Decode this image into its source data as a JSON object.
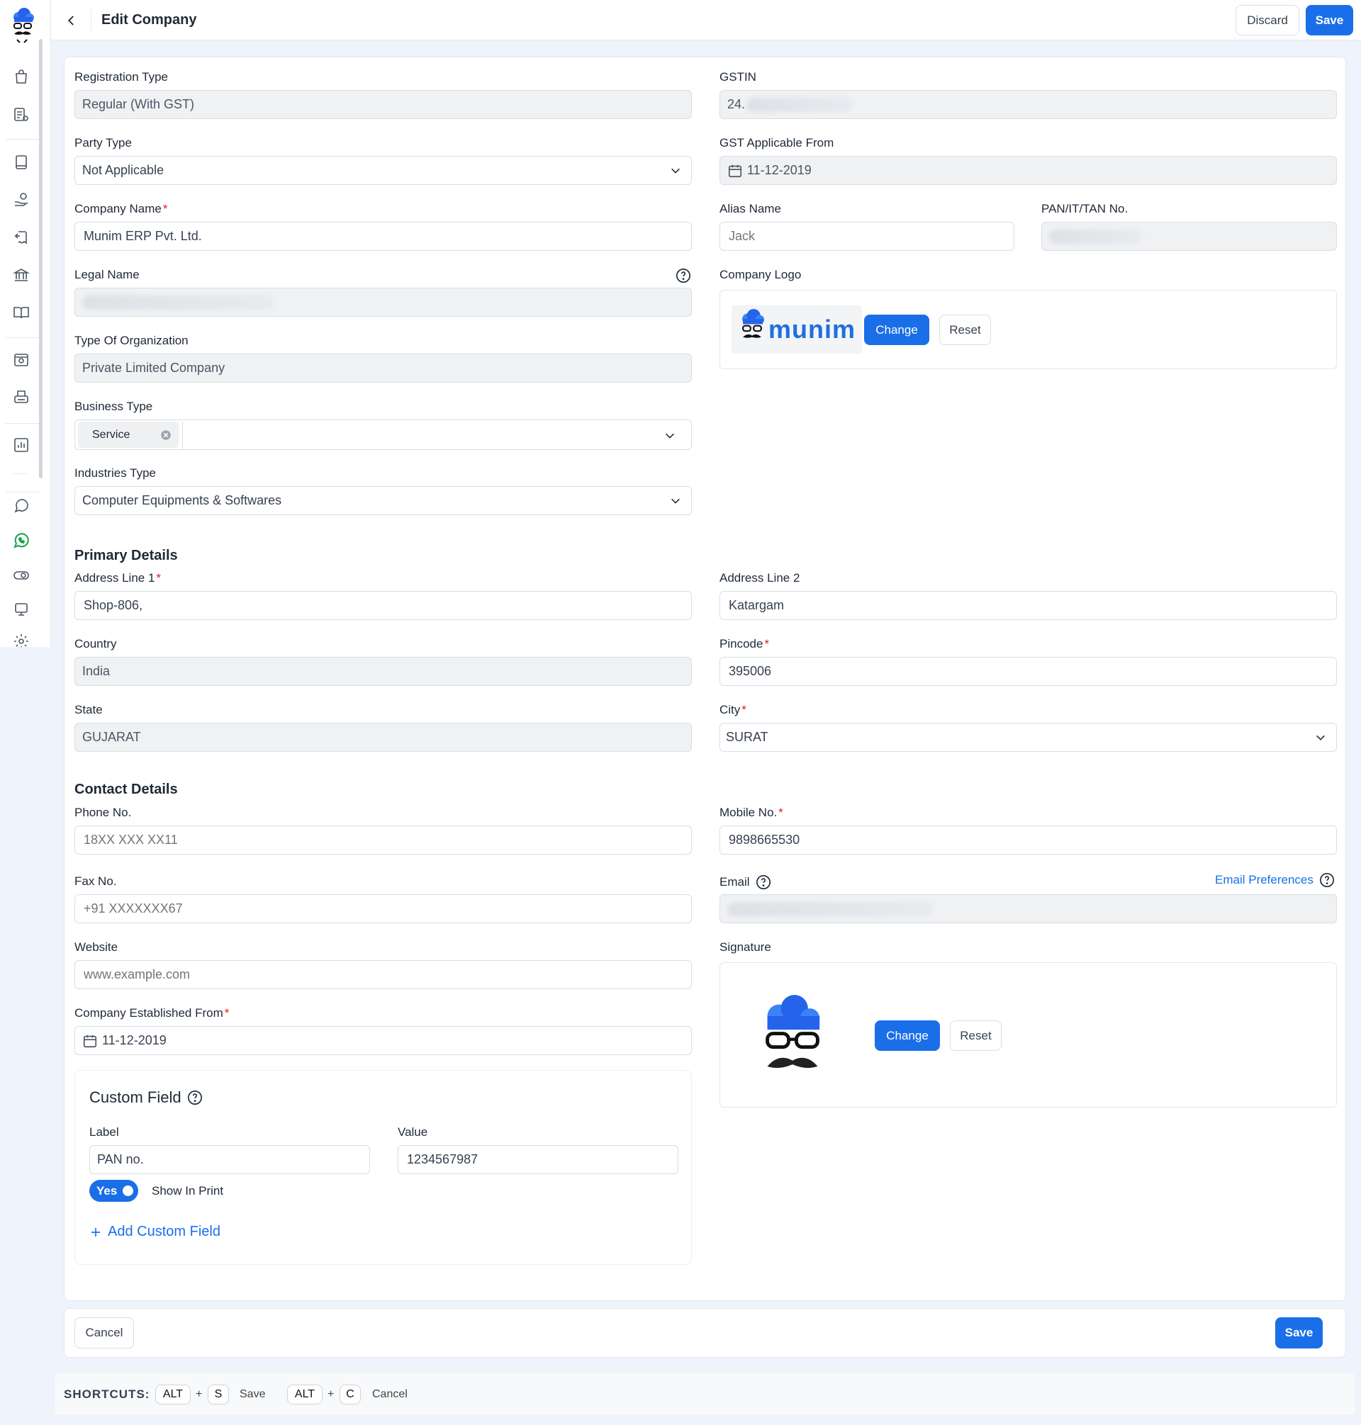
{
  "header": {
    "title": "Edit Company",
    "discard": "Discard",
    "save": "Save"
  },
  "sidebar": {
    "icons": [
      "cloud-logo-icon",
      "bag-icon",
      "list-icon",
      "book-icon",
      "hand-coins-icon",
      "return-icon",
      "bank-icon",
      "open-book-icon",
      "settings-box-icon",
      "printer-icon",
      "bar-chart-icon",
      "chat-icon",
      "whatsapp-icon",
      "toggle-icon",
      "monitor-icon",
      "gear-icon"
    ]
  },
  "form": {
    "registration_type": {
      "label": "Registration Type",
      "value": "Regular (With GST)"
    },
    "gstin": {
      "label": "GSTIN",
      "value": "24."
    },
    "party_type": {
      "label": "Party Type",
      "value": "Not Applicable"
    },
    "gst_applicable_from": {
      "label": "GST Applicable From",
      "value": "11-12-2019"
    },
    "company_name": {
      "label": "Company Name",
      "value": "Munim ERP Pvt. Ltd."
    },
    "alias_name": {
      "label": "Alias Name",
      "placeholder": "Jack"
    },
    "pan": {
      "label": "PAN/IT/TAN No."
    },
    "legal_name": {
      "label": "Legal Name"
    },
    "company_logo": {
      "label": "Company Logo",
      "logo_text": "munim",
      "change": "Change",
      "reset": "Reset"
    },
    "type_of_org": {
      "label": "Type Of Organization",
      "value": "Private Limited Company"
    },
    "business_type": {
      "label": "Business Type",
      "tag": "Service"
    },
    "industries_type": {
      "label": "Industries Type",
      "value": "Computer Equipments & Softwares"
    }
  },
  "primary": {
    "title": "Primary Details",
    "address1": {
      "label": "Address Line 1",
      "value": "Shop-806,"
    },
    "address2": {
      "label": "Address Line 2",
      "value": "Katargam"
    },
    "country": {
      "label": "Country",
      "value": "India"
    },
    "pincode": {
      "label": "Pincode",
      "value": "395006"
    },
    "state": {
      "label": "State",
      "value": "GUJARAT"
    },
    "city": {
      "label": "City",
      "value": "SURAT"
    }
  },
  "contact": {
    "title": "Contact Details",
    "phone": {
      "label": "Phone No.",
      "placeholder": "18XX XXX XX11"
    },
    "mobile": {
      "label": "Mobile No.",
      "value": "9898665530"
    },
    "fax": {
      "label": "Fax No.",
      "placeholder": "+91 XXXXXXX67"
    },
    "email": {
      "label": "Email",
      "preferences": "Email Preferences"
    },
    "website": {
      "label": "Website",
      "placeholder": "www.example.com"
    },
    "signature": {
      "label": "Signature",
      "change": "Change",
      "reset": "Reset"
    },
    "established": {
      "label": "Company Established From",
      "value": "11-12-2019"
    }
  },
  "custom_field": {
    "title": "Custom Field",
    "label_header": "Label",
    "value_header": "Value",
    "label_value": "PAN no.",
    "value_value": "1234567987",
    "toggle": "Yes",
    "show_in_print": "Show In Print",
    "add": "Add Custom Field"
  },
  "footer": {
    "cancel": "Cancel",
    "save": "Save"
  },
  "shortcuts": {
    "title": "SHORTCUTS:",
    "alt": "ALT",
    "plus": "+",
    "s": "S",
    "save": "Save",
    "c": "C",
    "cancel": "Cancel"
  },
  "colors": {
    "primary": "#1a6fe8",
    "required": "#e11d1d",
    "background": "#eef3fc"
  }
}
